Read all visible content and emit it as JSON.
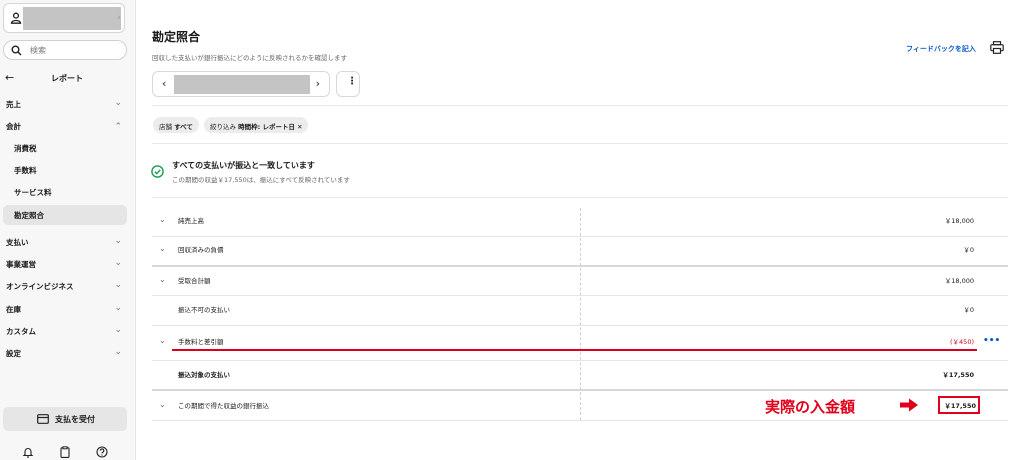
{
  "sidebar": {
    "search_placeholder": "検索",
    "back_label": "レポート",
    "nav": {
      "sales": "売上",
      "accounting": "会計",
      "accounting_items": [
        "消費税",
        "手数料",
        "サービス料",
        "勘定照合"
      ],
      "payments": "支払い",
      "operations": "事業運営",
      "online_business": "オンラインビジネス",
      "inventory": "在庫",
      "custom": "カスタム",
      "settings": "設定"
    },
    "accept_payment_label": "支払を受付"
  },
  "header": {
    "title": "勘定照合",
    "subtitle": "回収した支払いが銀行振込にどのように反映されるかを確認します",
    "feedback_label": "フィードバックを記入"
  },
  "filters": {
    "store_label": "店舗",
    "store_value": "すべて",
    "filter_label": "絞り込み",
    "filter_value": "時間枠: レポート日",
    "remove_symbol": "✕"
  },
  "status": {
    "title": "すべての支払いが振込と一致しています",
    "detail": "この期間の収益￥17,550は、振込にすべて反映されています"
  },
  "rows": [
    {
      "label": "純売上高",
      "value": "￥18,000",
      "expandable": true
    },
    {
      "label": "回収済みの負債",
      "value": "￥0",
      "expandable": true
    },
    {
      "label": "受取合計額",
      "value": "￥18,000",
      "expandable": true
    },
    {
      "label": "振込不可の支払い",
      "value": "￥0",
      "expandable": false
    },
    {
      "label": "手数料と差引額",
      "value": "(￥450)",
      "expandable": true
    },
    {
      "label": "振込対象の支払い",
      "value": "￥17,550",
      "expandable": false
    },
    {
      "label": "この期間で得た収益の銀行振込",
      "value": "￥17,550",
      "expandable": true
    }
  ],
  "annotation": {
    "text": "実際の入金額"
  },
  "colors": {
    "accent_blue": "#0a58c9",
    "annotation_red": "#e0001b",
    "negative_value": "#d6001c",
    "success_green": "#1c9c55"
  }
}
